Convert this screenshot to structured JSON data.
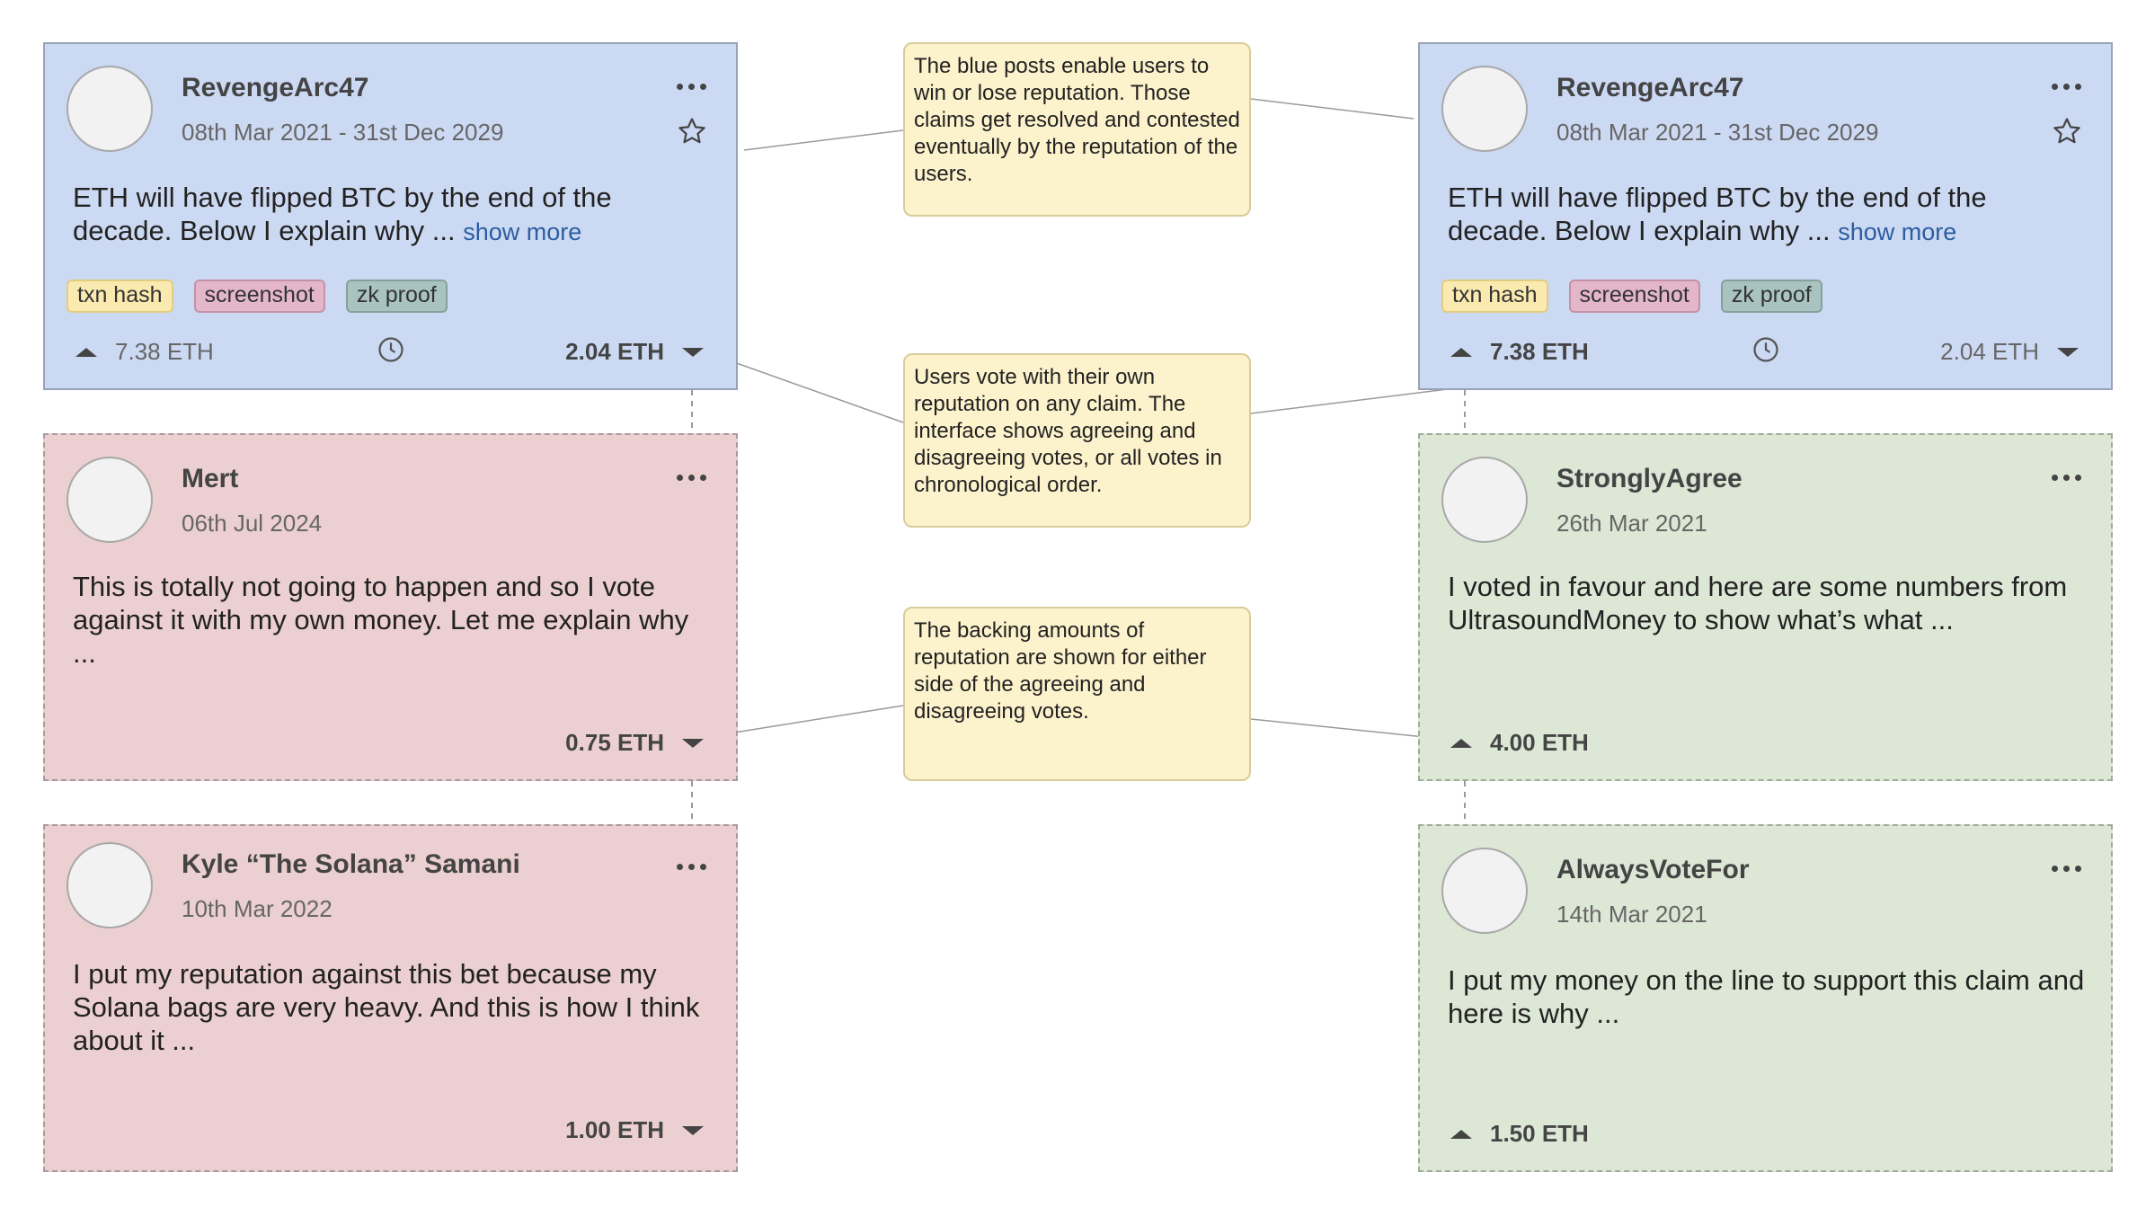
{
  "cards": {
    "claim_left": {
      "user": "RevengeArc47",
      "date": "08th Mar 2021 - 31st Dec 2029",
      "text": "ETH will have flipped BTC by the end of the decade. Below I explain why ...",
      "show_more": "show more",
      "tags": [
        "txn hash",
        "screenshot",
        "zk proof"
      ],
      "up_amount": "7.38 ETH",
      "down_amount": "2.04 ETH",
      "up_bold": false,
      "down_bold": true
    },
    "claim_right": {
      "user": "RevengeArc47",
      "date": "08th Mar 2021 - 31st Dec 2029",
      "text": "ETH will have flipped BTC by the end of the decade. Below I explain why ...",
      "show_more": "show more",
      "tags": [
        "txn hash",
        "screenshot",
        "zk proof"
      ],
      "up_amount": "7.38 ETH",
      "down_amount": "2.04 ETH",
      "up_bold": true,
      "down_bold": false
    },
    "mert": {
      "user": "Mert",
      "date": "06th Jul 2024",
      "text": "This is totally not going to happen and so I vote against it with my own money. Let me explain why ...",
      "amount": "0.75 ETH"
    },
    "kyle": {
      "user": "Kyle “The Solana” Samani",
      "date": "10th Mar 2022",
      "text": "I put my reputation against this bet because my Solana bags are very heavy. And this is how I think about it ...",
      "amount": "1.00 ETH"
    },
    "strongly": {
      "user": "StronglyAgree",
      "date": "26th Mar 2021",
      "text": "I voted in favour and here are some numbers from UltrasoundMoney to show what’s what ...",
      "amount": "4.00 ETH"
    },
    "always": {
      "user": "AlwaysVoteFor",
      "date": "14th Mar 2021",
      "text": "I put my money on the line to support this claim and here is why ...",
      "amount": "1.50 ETH"
    }
  },
  "notes": {
    "blue_posts": "The blue posts enable users to win or lose reputation. Those claims get resolved and contested eventually by the reputation of the users.",
    "vote": "Users vote with their own reputation on any claim. The interface shows agreeing and disagreeing votes, or all votes in chronological order.",
    "backing": "The backing amounts of reputation are shown for either side of the agreeing and disagreeing votes."
  },
  "colors": {
    "claim_bg": "#ccd9f3",
    "disagree_bg": "#eccfd0",
    "agree_bg": "#dde7d5",
    "note_bg": "#fcf2cc",
    "link": "#2b5da0"
  }
}
